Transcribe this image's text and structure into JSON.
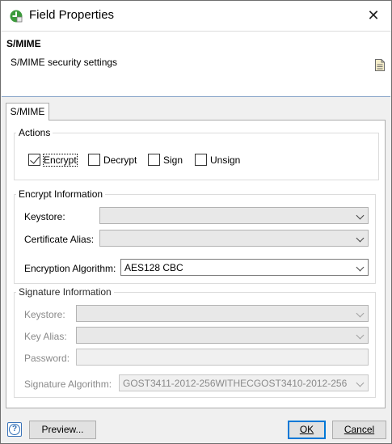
{
  "window": {
    "title": "Field Properties"
  },
  "banner": {
    "title": "S/MIME",
    "description": "S/MIME security settings"
  },
  "tabs": [
    {
      "label": "S/MIME",
      "selected": true
    }
  ],
  "actions": {
    "legend": "Actions",
    "items": [
      {
        "label": "Encrypt",
        "checked": true
      },
      {
        "label": "Decrypt",
        "checked": false
      },
      {
        "label": "Sign",
        "checked": false
      },
      {
        "label": "Unsign",
        "checked": false
      }
    ]
  },
  "encrypt_info": {
    "legend": "Encrypt Information",
    "keystore_label": "Keystore:",
    "keystore_value": "",
    "cert_alias_label": "Certificate Alias:",
    "cert_alias_value": "",
    "algorithm_label": "Encryption Algorithm:",
    "algorithm_value": "AES128 CBC"
  },
  "signature_info": {
    "legend": "Signature Information",
    "keystore_label": "Keystore:",
    "keystore_value": "",
    "key_alias_label": "Key Alias:",
    "key_alias_value": "",
    "password_label": "Password:",
    "password_value": "",
    "algorithm_label": "Signature Algorithm:",
    "algorithm_value": "GOST3411-2012-256WITHECGOST3410-2012-256"
  },
  "footer": {
    "preview_label": "Preview...",
    "ok_label": "OK",
    "cancel_label": "Cancel"
  },
  "colors": {
    "accent": "#0078d7",
    "title_icon_green": "#3c9a3c"
  }
}
